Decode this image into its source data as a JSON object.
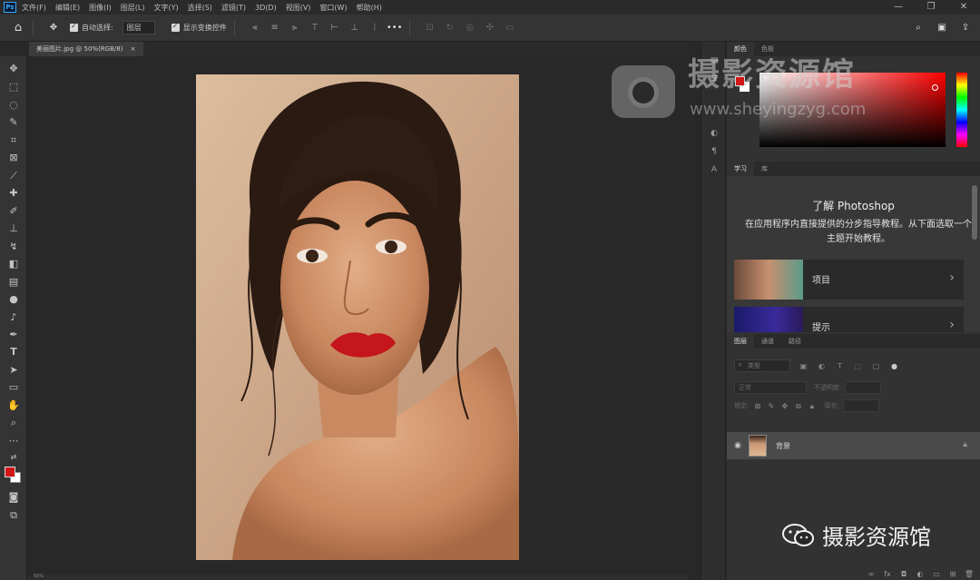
{
  "app": {
    "logo": "Ps"
  },
  "menu": [
    "文件(F)",
    "编辑(E)",
    "图像(I)",
    "图层(L)",
    "文字(Y)",
    "选择(S)",
    "滤镜(T)",
    "3D(D)",
    "视图(V)",
    "窗口(W)",
    "帮助(H)"
  ],
  "window_controls": {
    "minimize": "—",
    "restore": "❐",
    "close": "✕"
  },
  "options": {
    "auto_select_label": "自动选择:",
    "auto_select_value": "图层",
    "show_transform_label": "显示变换控件",
    "more": "•••"
  },
  "document": {
    "tab_title": "美丽图片.jpg @ 50%(RGB/8)",
    "tab_close": "×",
    "status": "50%"
  },
  "colors": {
    "foreground": "#d21616",
    "background": "#ffffff",
    "accent": "#31a8ff"
  },
  "panels": {
    "color_tabs": [
      "颜色",
      "色板"
    ],
    "learn_tabs": [
      "学习",
      "库"
    ],
    "learn_title": "了解 Photoshop",
    "learn_desc": "在应用程序内直接提供的分步指导教程。从下面选取一个主题开始教程。",
    "learn_cards": [
      {
        "label": "项目",
        "chevron": "›"
      },
      {
        "label": "提示",
        "chevron": "›"
      }
    ],
    "layers_tabs": [
      "图层",
      "通道",
      "路径"
    ],
    "filter_placeholder": "类型",
    "blend_mode": "正常",
    "opacity_label": "不透明度:",
    "lock_label": "锁定:",
    "fill_label": "填充:",
    "layer_name": "背景"
  },
  "watermark": {
    "title": "摄影资源馆",
    "url": "www.sheyingzyg.com",
    "bottom_text": "摄影资源馆"
  }
}
